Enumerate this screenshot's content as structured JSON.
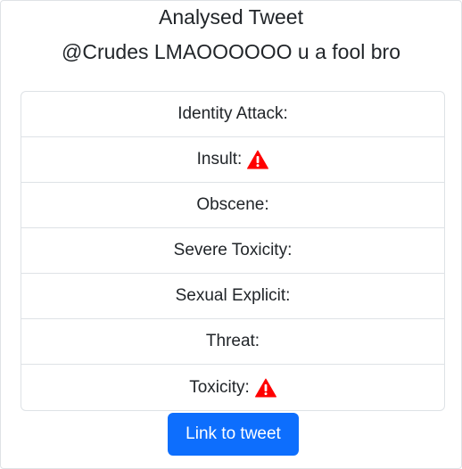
{
  "heading": "Analysed Tweet",
  "tweet_text": "@Crudes LMAOOOOOO u a fool bro",
  "categories": [
    {
      "label": "Identity Attack:",
      "flagged": false
    },
    {
      "label": "Insult:",
      "flagged": true
    },
    {
      "label": "Obscene:",
      "flagged": false
    },
    {
      "label": "Severe Toxicity:",
      "flagged": false
    },
    {
      "label": "Sexual Explicit:",
      "flagged": false
    },
    {
      "label": "Threat:",
      "flagged": false
    },
    {
      "label": "Toxicity:",
      "flagged": true
    }
  ],
  "warning_icon": "warning-triangle-icon",
  "warning_color": "#ff0000",
  "link_button_label": "Link to tweet",
  "accent_color": "#0d6efd"
}
